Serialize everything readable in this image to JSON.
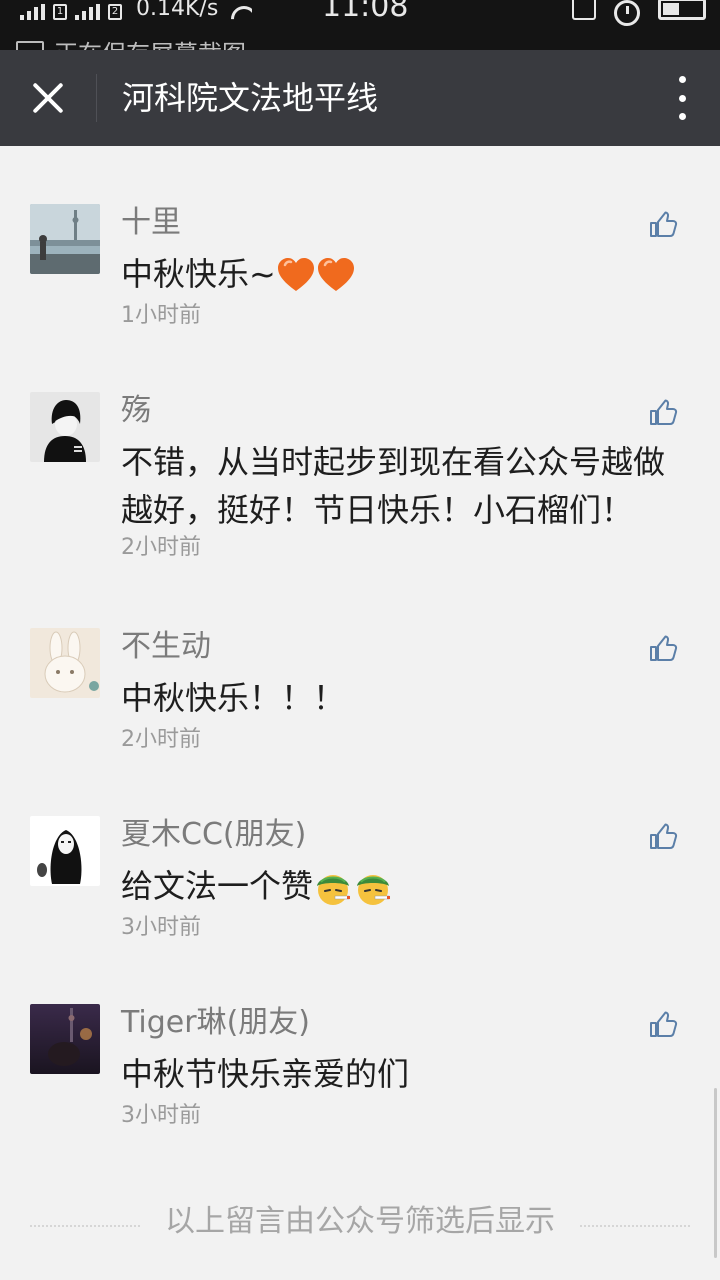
{
  "status_bar": {
    "network_speed": "0.14K/s",
    "time": "11:08",
    "sim1": "1",
    "sim2": "2",
    "notification": "正在保存屏幕截图"
  },
  "header": {
    "title": "河科院文法地平线",
    "close_icon": "close-icon",
    "more_icon": "more-vertical-icon",
    "background": "#393a3f"
  },
  "comments": [
    {
      "name": "十里",
      "text": "中秋快乐~",
      "emoji": [
        "heart",
        "heart"
      ],
      "time": "1小时前"
    },
    {
      "name": "殇",
      "text": "不错，从当时起步到现在看公众号越做越好，挺好！节日快乐！小石榴们！",
      "emoji": [],
      "time": "2小时前"
    },
    {
      "name": "不生动",
      "text": "中秋快乐！！！",
      "emoji": [],
      "time": "2小时前"
    },
    {
      "name": "夏木CC(朋友)",
      "text": "给文法一个赞",
      "emoji": [
        "smoking-face",
        "smoking-face"
      ],
      "time": "3小时前"
    },
    {
      "name": "Tiger琳(朋友)",
      "text": "中秋节快乐亲爱的们",
      "emoji": [],
      "time": "3小时前"
    }
  ],
  "footer": {
    "text": "以上留言由公众号筛选后显示"
  },
  "colors": {
    "page_bg": "#f2f2f2",
    "like_icon": "#5b7fa8",
    "name_text": "#7b7b7b",
    "body_text": "#1e1e1e"
  }
}
